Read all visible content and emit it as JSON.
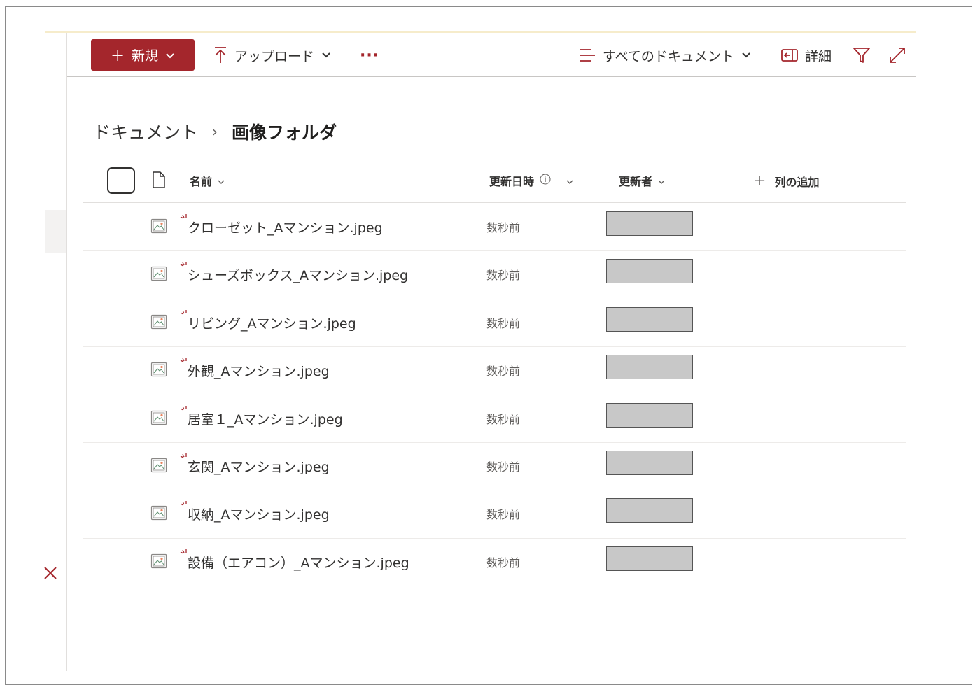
{
  "commandbar": {
    "new_label": "新規",
    "upload_label": "アップロード",
    "more_label": "···",
    "view_label": "すべてのドキュメント",
    "details_label": "詳細"
  },
  "breadcrumb": {
    "parent": "ドキュメント",
    "separator": "›",
    "current": "画像フォルダ"
  },
  "columns": {
    "name": "名前",
    "modified": "更新日時",
    "modified_by": "更新者",
    "add_column": "列の追加"
  },
  "files": [
    {
      "name": "クローゼット_Aマンション.jpeg",
      "modified": "数秒前"
    },
    {
      "name": "シューズボックス_Aマンション.jpeg",
      "modified": "数秒前"
    },
    {
      "name": "リビング_Aマンション.jpeg",
      "modified": "数秒前"
    },
    {
      "name": "外観_Aマンション.jpeg",
      "modified": "数秒前"
    },
    {
      "name": "居室１_Aマンション.jpeg",
      "modified": "数秒前"
    },
    {
      "name": "玄関_Aマンション.jpeg",
      "modified": "数秒前"
    },
    {
      "name": "収納_Aマンション.jpeg",
      "modified": "数秒前"
    },
    {
      "name": "設備（エアコン）_Aマンション.jpeg",
      "modified": "数秒前"
    }
  ],
  "icons": {
    "file_row": "image-file-icon",
    "new_marker": "new-item-sparkle-icon",
    "left_close": "close-icon"
  },
  "colors": {
    "accent": "#a4262c",
    "redaction": "#c8c8c8"
  }
}
